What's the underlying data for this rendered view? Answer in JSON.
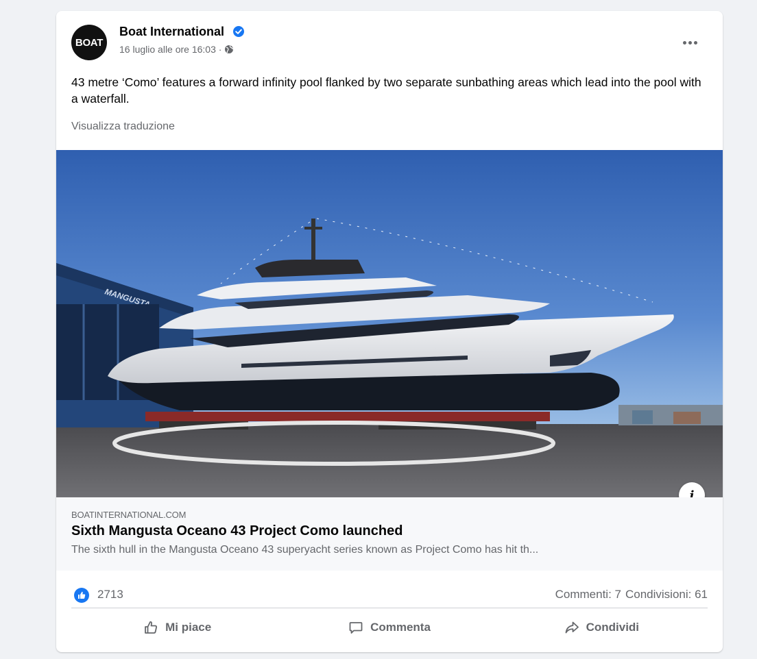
{
  "post": {
    "avatar_text": "BOAT",
    "page_name": "Boat International",
    "timestamp": "16 luglio alle ore 16:03 ·",
    "privacy_icon": "globe-icon",
    "verified_icon": "verified-badge-icon",
    "more_icon": "more-options-icon",
    "text": "43 metre ‘Como’ features a forward infinity pool flanked by two separate sunbathing areas which lead into the pool with a waterfall.",
    "see_translation": "Visualizza traduzione"
  },
  "link_preview": {
    "domain": "BOATINTERNATIONAL.COM",
    "title": "Sixth Mangusta Oceano 43 Project Como launched",
    "description": "The sixth hull in the Mangusta Oceano 43 superyacht series known as Project Como has hit th...",
    "info_icon": "i",
    "building_sign": "MANGUSTA"
  },
  "reactions": {
    "like_icon": "like-reaction-icon",
    "like_count": "2713",
    "comments": "Commenti: 7",
    "shares": "Condivisioni: 61"
  },
  "actions": {
    "like": "Mi piace",
    "comment": "Commenta",
    "share": "Condividi"
  },
  "colors": {
    "brand_blue": "#1877f2",
    "secondary_text": "#65676b",
    "page_background": "#f0f2f5"
  }
}
